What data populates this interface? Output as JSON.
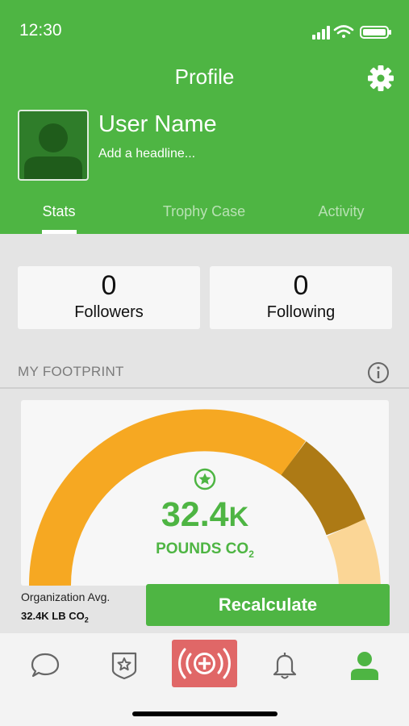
{
  "status_bar": {
    "time": "12:30"
  },
  "header": {
    "title": "Profile"
  },
  "user": {
    "name": "User Name",
    "headline_placeholder": "Add a headline..."
  },
  "tabs": [
    {
      "label": "Stats",
      "active": true
    },
    {
      "label": "Trophy Case",
      "active": false
    },
    {
      "label": "Activity",
      "active": false
    }
  ],
  "social": {
    "followers": {
      "count": "0",
      "label": "Followers"
    },
    "following": {
      "count": "0",
      "label": "Following"
    }
  },
  "footprint": {
    "section_label": "MY FOOTPRINT",
    "value": "32.4",
    "value_suffix": "K",
    "unit_main": "POUNDS CO",
    "unit_sub": "2",
    "org_avg_label": "Organization Avg.",
    "org_avg_value": "32.4K LB CO",
    "org_avg_sub": "2",
    "recalculate_label": "Recalculate"
  },
  "colors": {
    "brand_green": "#4eb543",
    "gauge_orange": "#f6a822",
    "gauge_brown": "#ad7a15",
    "gauge_light": "#fbd696",
    "alert_red": "#e06767"
  },
  "bottom_nav": {
    "items": [
      "chat-icon",
      "badge-star-icon",
      "alert-plus-icon",
      "bell-icon",
      "profile-icon"
    ]
  }
}
